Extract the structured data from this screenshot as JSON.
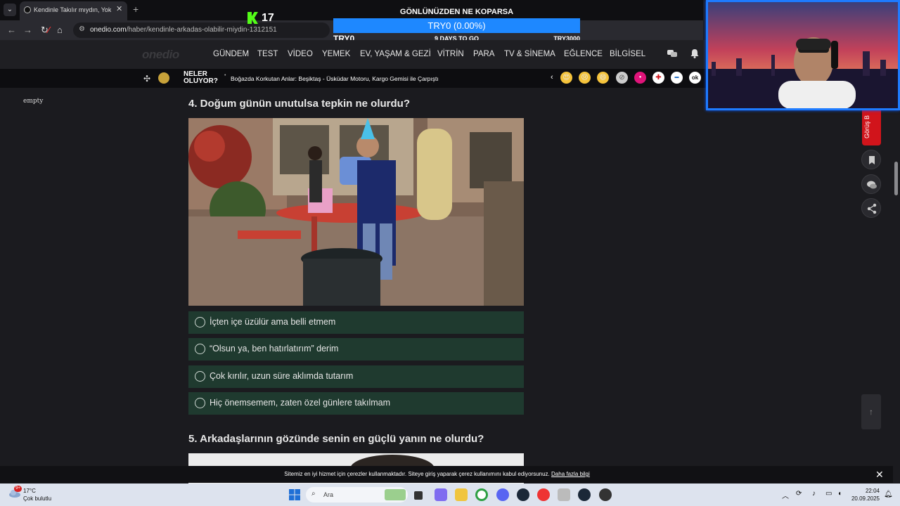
{
  "browser": {
    "tab_title": "Kendinle Takılır mıydın, Yoksa Kendini Sıkıcı mı Bulurdun?",
    "url_host": "onedio.com",
    "url_path": "/haber/kendinle-arkadas-olabilir-miydin-1312151"
  },
  "stream": {
    "kick_count": "17",
    "goal_title": "GÖNLÜNÜZDEN NE KOPARSA",
    "goal_bar": "TRY0 (0.00%)",
    "goal_progress": 0,
    "goal_left": "TRY0",
    "goal_days": "9 DAYS TO GO",
    "goal_target": "TRY3000"
  },
  "site": {
    "logo": "onedio",
    "nav": [
      "GÜNDEM",
      "TEST",
      "VİDEO",
      "YEMEK",
      "EV, YAŞAM & GEZİ",
      "VİTRİN",
      "PARA",
      "TV & SİNEMA",
      "EĞLENCE",
      "BİLGİSEL"
    ],
    "news_label_1": "NELER",
    "news_label_2": "OLUYOR?",
    "ticker": "Boğazda Korkutan Anlar: Beşiktaş - Üsküdar Motoru, Kargo Gemisi ile Çarpıştı"
  },
  "left_text": "empty",
  "q4": {
    "title": "4. Doğum günün unutulsa tepkin ne olurdu?",
    "options": [
      "İçten içe üzülür ama belli etmem",
      "“Olsun ya, ben hatırlatırım” derim",
      "Çok kırılır, uzun süre aklımda tutarım",
      "Hiç önemsemem, zaten özel günlere takılmam"
    ]
  },
  "q5": {
    "title": "5. Arkadaşlarının gözünde senin en güçlü yanın ne olurdu?"
  },
  "side": {
    "gorus": "Görüş B"
  },
  "cookie": {
    "text": "Sitemiz en iyi hizmet için çerezler kullanmaktadır. Siteye giriş yaparak çerez kullanımını kabul ediyorsunuz.",
    "link": "Daha fazla bilgi"
  },
  "taskbar": {
    "weather_badge": "9+",
    "temp": "17°C",
    "weather": "Çok bulutlu",
    "search": "Ara",
    "time": "22:04",
    "date": "20.09.2025"
  },
  "colors": {
    "option_bg": "#1f3a2f",
    "goal_bar": "#1e88ff",
    "accent_red": "#d1141b",
    "kick_green": "#53fc18"
  }
}
